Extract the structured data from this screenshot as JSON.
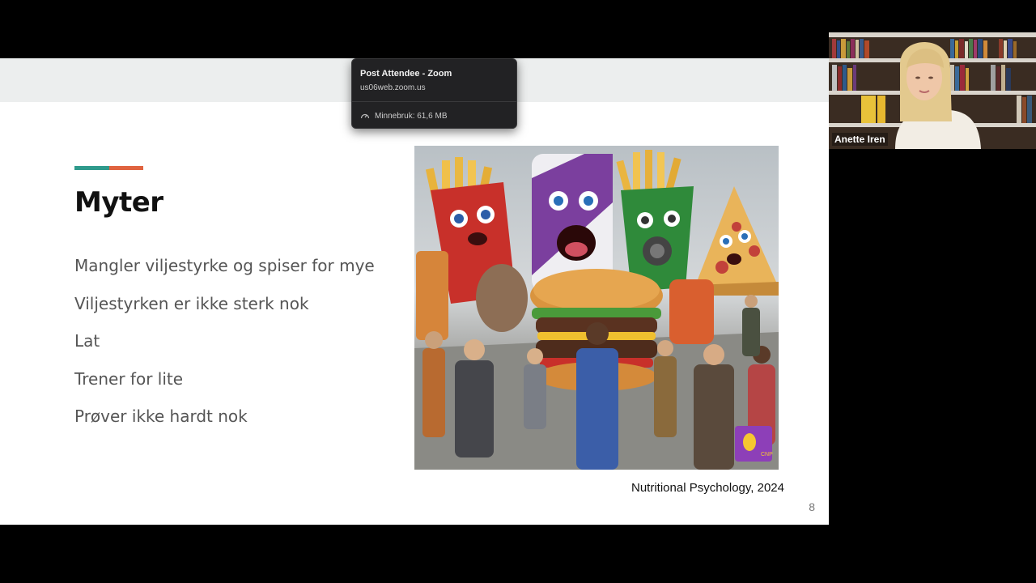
{
  "tooltip": {
    "title": "Post Attendee - Zoom",
    "url": "us06web.zoom.us",
    "memory_label": "Minnebruk: 61,6 MB",
    "memory_icon": "gauge-icon"
  },
  "slide": {
    "title": "Myter",
    "bullets": [
      "Mangler viljestyrke og spiser for mye",
      "Viljestyrken er ikke sterk nok",
      "Lat",
      "Trener for lite",
      "Prøver ikke hardt nok"
    ],
    "caption": "Nutritional Psychology, 2024",
    "page_number": "8",
    "accent_colors": [
      "#2f9a8c",
      "#e0633f"
    ],
    "image_logo_text": "CNP"
  },
  "video": {
    "participant_name": "Anette Iren"
  }
}
